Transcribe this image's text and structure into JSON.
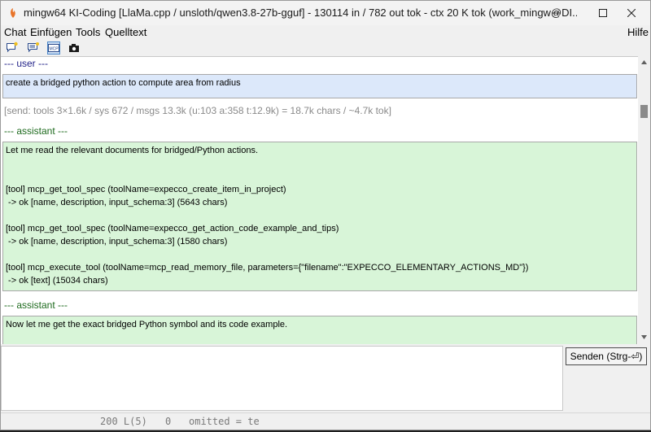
{
  "window": {
    "title": "mingw64 KI-Coding [LlaMa.cpp / unsloth/qwen3.8-27b-gguf] - 130114 in / 782 out tok - ctx 20 K tok (work_mingw@DI..."
  },
  "menu": {
    "chat": "Chat",
    "insert": "Einfügen",
    "tools": "Tools",
    "source": "Quelltext",
    "help": "Hilfe"
  },
  "toolbar": {
    "mcp_label": "MCP"
  },
  "chat": {
    "user_label": "--- user ---",
    "user_message": "create a bridged python action to compute area from radius",
    "stats": "[send: tools 3×1.6k / sys 672 / msgs 13.3k (u:103 a:358 t:12.9k) = 18.7k chars / ~4.7k tok]",
    "assistant_label_1": "--- assistant ---",
    "assistant_message_1": "Let me read the relevant documents for bridged/Python actions.\n\n\n[tool] mcp_get_tool_spec (toolName=expecco_create_item_in_project)\n -> ok [name, description, input_schema:3] (5643 chars)\n\n[tool] mcp_get_tool_spec (toolName=expecco_get_action_code_example_and_tips)\n -> ok [name, description, input_schema:3] (1580 chars)\n\n[tool] mcp_execute_tool (toolName=mcp_read_memory_file, parameters={\"filename\":\"EXPECCO_ELEMENTARY_ACTIONS_MD\"})\n -> ok [text] (15034 chars)",
    "assistant_label_2": "--- assistant ---",
    "assistant_message_2": "Now let me get the exact bridged Python symbol and its code example."
  },
  "input": {
    "value": "",
    "send_label": "Senden (Strg-⏎)"
  },
  "background": {
    "fragment_left": "200 L(5)",
    "fragment_mid": "0",
    "fragment_right": "omitted = te"
  },
  "colors": {
    "user_bg": "#dce8fa",
    "assistant_bg": "#d8f5d8",
    "user_label": "#24248a",
    "assistant_label": "#1d6a1d"
  }
}
